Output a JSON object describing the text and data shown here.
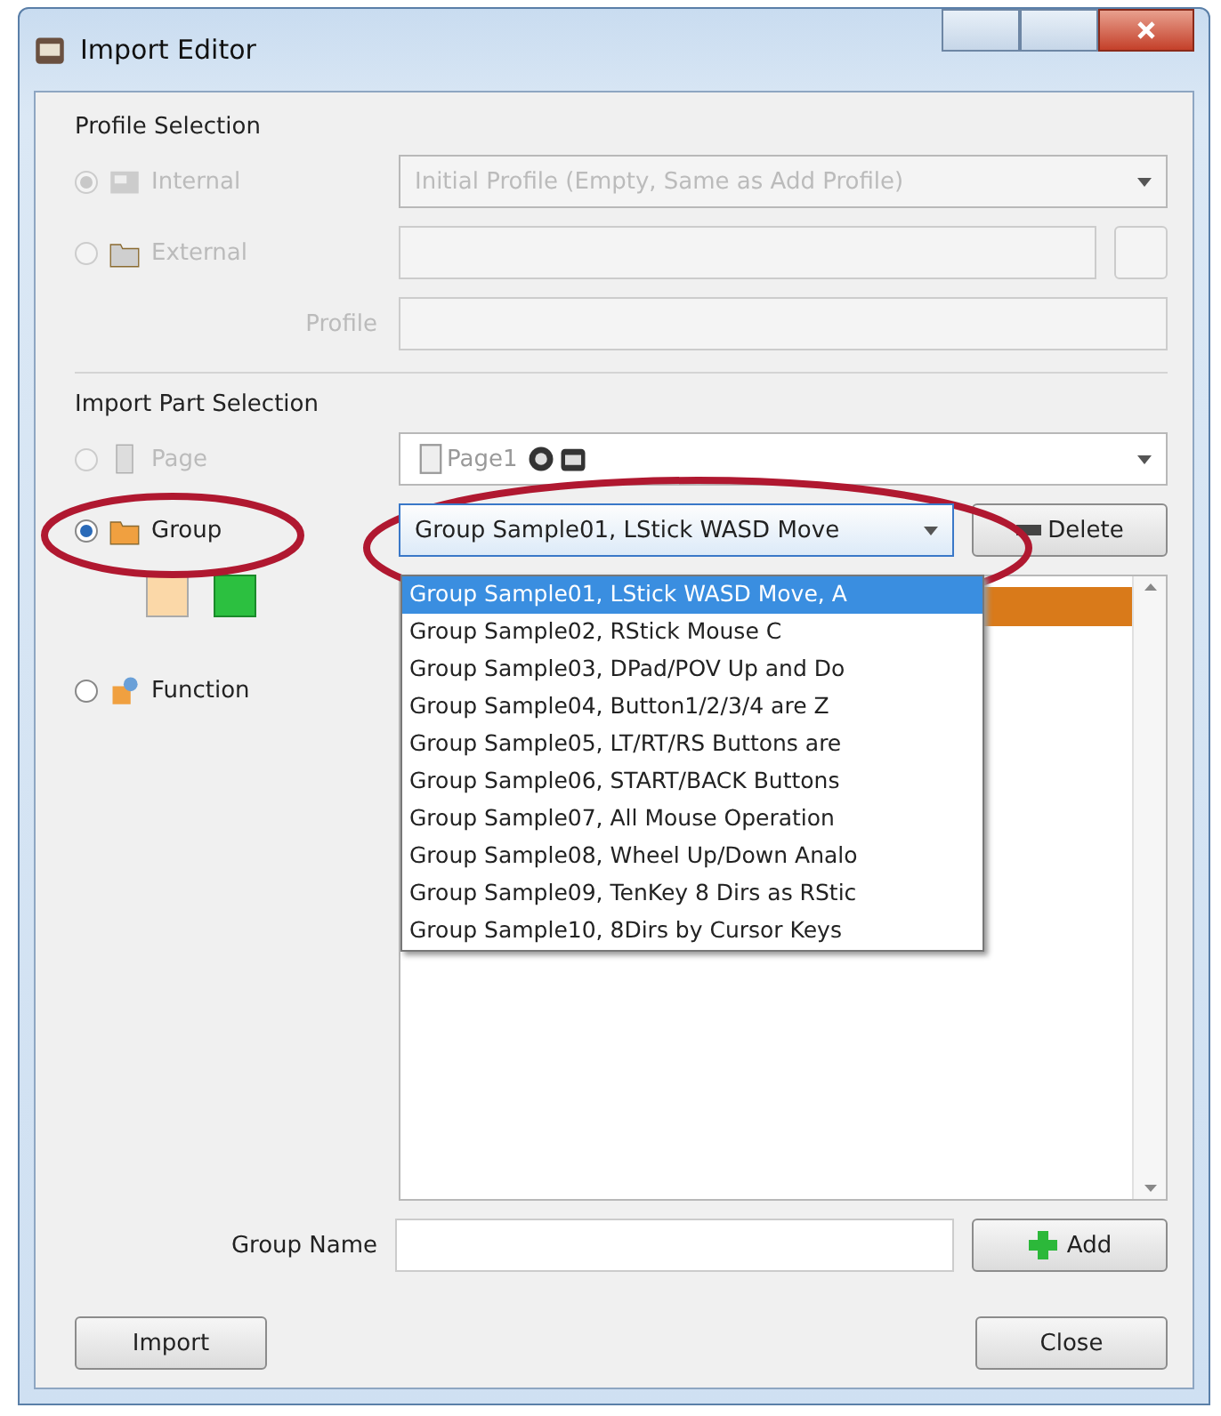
{
  "window": {
    "title": "Import Editor"
  },
  "profile_selection": {
    "title": "Profile Selection",
    "options": [
      {
        "kind": "internal",
        "label": "Internal",
        "selected": true,
        "disabled": true
      },
      {
        "kind": "external",
        "label": "External",
        "selected": false,
        "disabled": true
      }
    ],
    "profile_combo": {
      "value": "Initial Profile (Empty, Same as Add Profile)",
      "disabled": true
    },
    "profile_label": "Profile"
  },
  "import_part_selection": {
    "title": "Import Part Selection",
    "parts": [
      {
        "kind": "page",
        "label": "Page",
        "selected": false,
        "disabled": true
      },
      {
        "kind": "group",
        "label": "Group",
        "selected": true,
        "disabled": false
      },
      {
        "kind": "function",
        "label": "Function",
        "selected": false,
        "disabled": false
      }
    ],
    "page_combo": {
      "value": "Page1"
    },
    "group_combo": {
      "value": "Group Sample01, LStick WASD Move",
      "expanded": true,
      "options": [
        {
          "label": "Group Sample01, LStick WASD Move, A",
          "selected": true
        },
        {
          "label": "Group Sample02, RStick Mouse C",
          "selected": false
        },
        {
          "label": "Group Sample03, DPad/POV Up and Do",
          "selected": false
        },
        {
          "label": "Group Sample04, Button1/2/3/4 are Z",
          "selected": false
        },
        {
          "label": "Group Sample05, LT/RT/RS Buttons are",
          "selected": false
        },
        {
          "label": "Group Sample06, START/BACK Buttons",
          "selected": false
        },
        {
          "label": "Group Sample07, All Mouse Operation",
          "selected": false
        },
        {
          "label": "Group Sample08, Wheel Up/Down Analo",
          "selected": false
        },
        {
          "label": "Group Sample09, TenKey 8 Dirs as RStic",
          "selected": false
        },
        {
          "label": "Group Sample10, 8Dirs by Cursor Keys",
          "selected": false
        }
      ]
    },
    "delete_button": "Delete",
    "group_list": {
      "rows": [
        {
          "selected": true
        }
      ]
    },
    "group_name_label": "Group Name",
    "add_button": "Add"
  },
  "buttons": [
    "Import",
    "Close"
  ]
}
